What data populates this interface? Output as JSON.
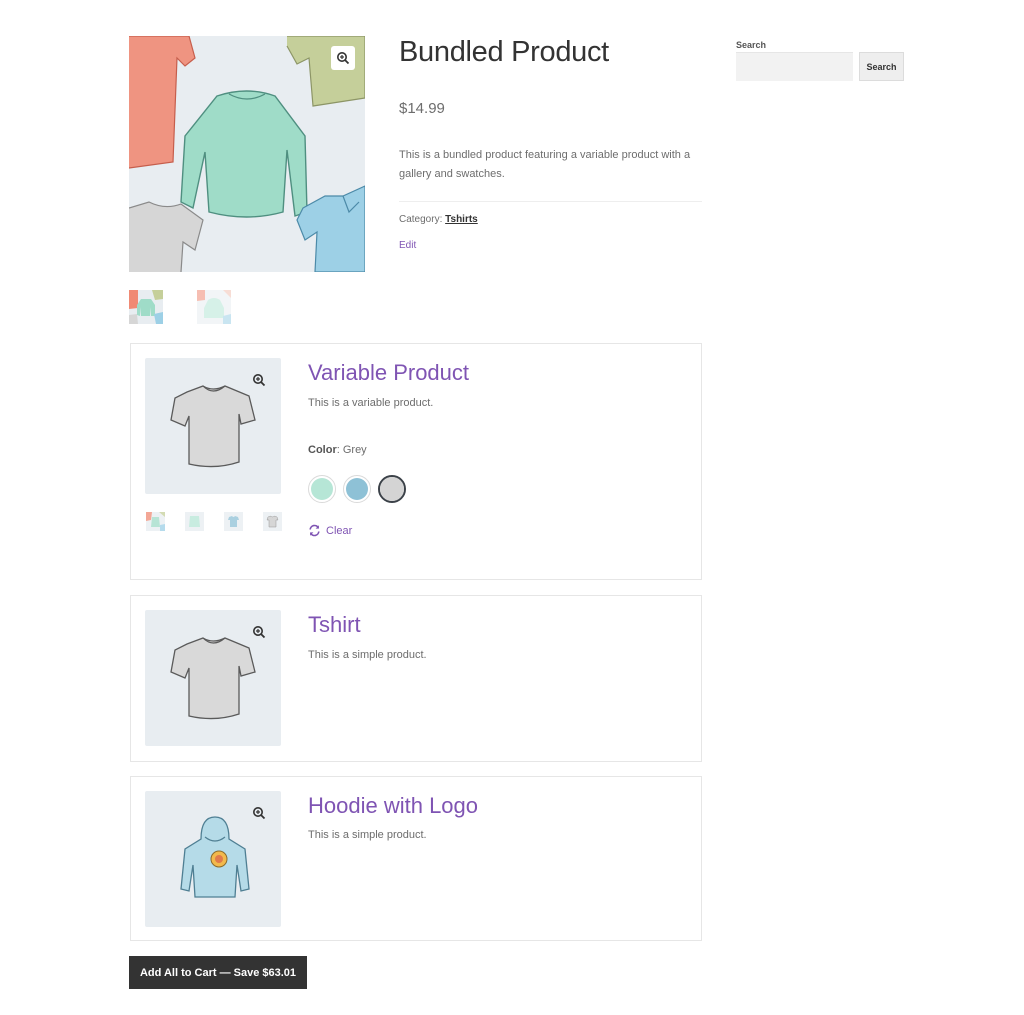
{
  "product": {
    "title": "Bundled Product",
    "price": "$14.99",
    "description": "This is a bundled product featuring a variable product with a gallery and swatches.",
    "category_label": "Category:",
    "category_value": "Tshirts",
    "edit_label": "Edit"
  },
  "sidebar": {
    "search_label": "Search",
    "search_button": "Search",
    "search_value": ""
  },
  "bundle_items": [
    {
      "title": "Variable Product",
      "description": "This is a variable product.",
      "color_label": "Color",
      "color_value": ": Grey",
      "swatch_colors": [
        "#b6e6d6",
        "#8ec1d6",
        "#d4d4d4"
      ],
      "selected_swatch": 2,
      "clear_label": "Clear"
    },
    {
      "title": "Tshirt",
      "description": "This is a simple product."
    },
    {
      "title": "Hoodie with Logo",
      "description": "This is a simple product."
    }
  ],
  "cart_button": "Add All to Cart — Save $63.01",
  "colors": {
    "accent": "#7f54b3",
    "button_dark": "#333333",
    "image_bg": "#e8edf1"
  }
}
